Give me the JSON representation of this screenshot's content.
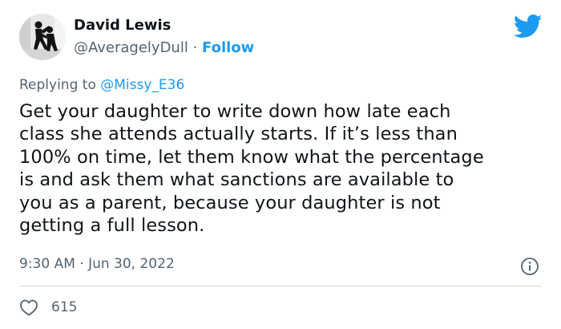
{
  "tweet": {
    "author_name": "David Lewis",
    "handle": "@AveragelyDull",
    "separator": " · ",
    "follow_label": "Follow",
    "replying_prefix": "Replying to ",
    "replying_to": "@Missy_E36",
    "text": "Get your daughter to write down how late each\nclass she attends actually starts. If it’s less than\n100% on time, let them know what the percentage\nis and ask them what sanctions are available to\nyou as a parent, because your daughter is not\ngetting a full lesson.",
    "timestamp": "9:30 AM · Jun 30, 2022",
    "like_count": "615"
  },
  "icons": {
    "brand": "twitter-bird-icon",
    "info": "info-icon",
    "like": "heart-icon"
  },
  "colors": {
    "accent": "#1d9bf0",
    "text": "#0f1419",
    "muted": "#536471",
    "divider": "#cfd9de"
  }
}
